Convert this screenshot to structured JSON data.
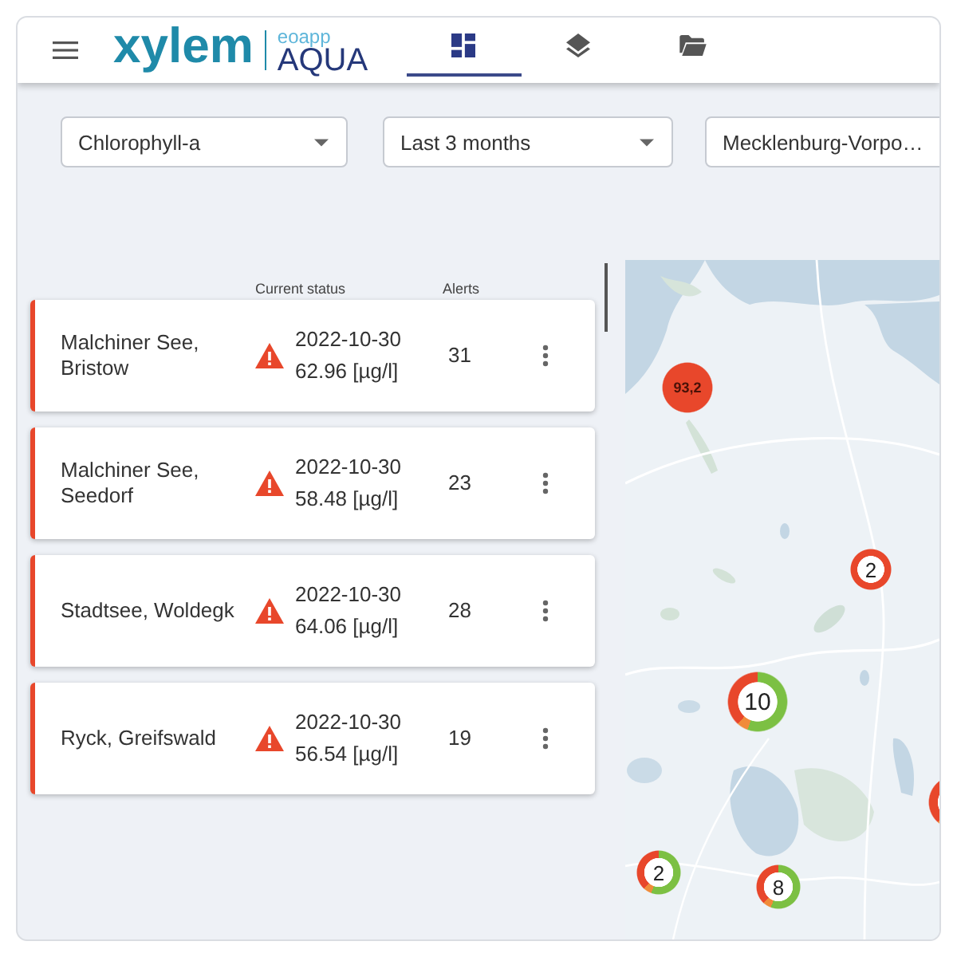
{
  "header": {
    "logo": {
      "brand": "xylem",
      "prefix": "eoapp",
      "product": "AQUA"
    },
    "tabs": [
      {
        "kind": "dashboard",
        "selected": true
      },
      {
        "kind": "layers",
        "selected": false
      },
      {
        "kind": "folder",
        "selected": false
      }
    ]
  },
  "filters": [
    {
      "kind": "dropdown",
      "value": "Chlorophyll-a"
    },
    {
      "kind": "dropdown",
      "value": "Last 3 months"
    },
    {
      "kind": "input",
      "value": "Mecklenburg-Vorpo…"
    }
  ],
  "list": {
    "columns": [
      "Current status",
      "Alerts"
    ],
    "sites": [
      {
        "name": "Malchiner See, Bristow",
        "alert": true,
        "date": "2022-10-30",
        "value": "62.96 [µg/l]",
        "alerts": "31"
      },
      {
        "name": "Malchiner See, Seedorf",
        "alert": true,
        "date": "2022-10-30",
        "value": "58.48 [µg/l]",
        "alerts": "23"
      },
      {
        "name": "Stadtsee, Woldegk",
        "alert": true,
        "date": "2022-10-30",
        "value": "64.06 [µg/l]",
        "alerts": "28"
      },
      {
        "name": "Ryck, Greifswald",
        "alert": true,
        "date": "2022-10-30",
        "value": "56.54 [µg/l]",
        "alerts": "19"
      }
    ]
  },
  "map": {
    "markers": [
      {
        "kind": "value",
        "label": "93,2"
      },
      {
        "kind": "alert",
        "label": "2"
      },
      {
        "kind": "mixed",
        "label": "10"
      },
      {
        "kind": "mixed",
        "label": "2"
      },
      {
        "kind": "mixed",
        "label": "8"
      },
      {
        "kind": "mixed"
      }
    ]
  }
}
